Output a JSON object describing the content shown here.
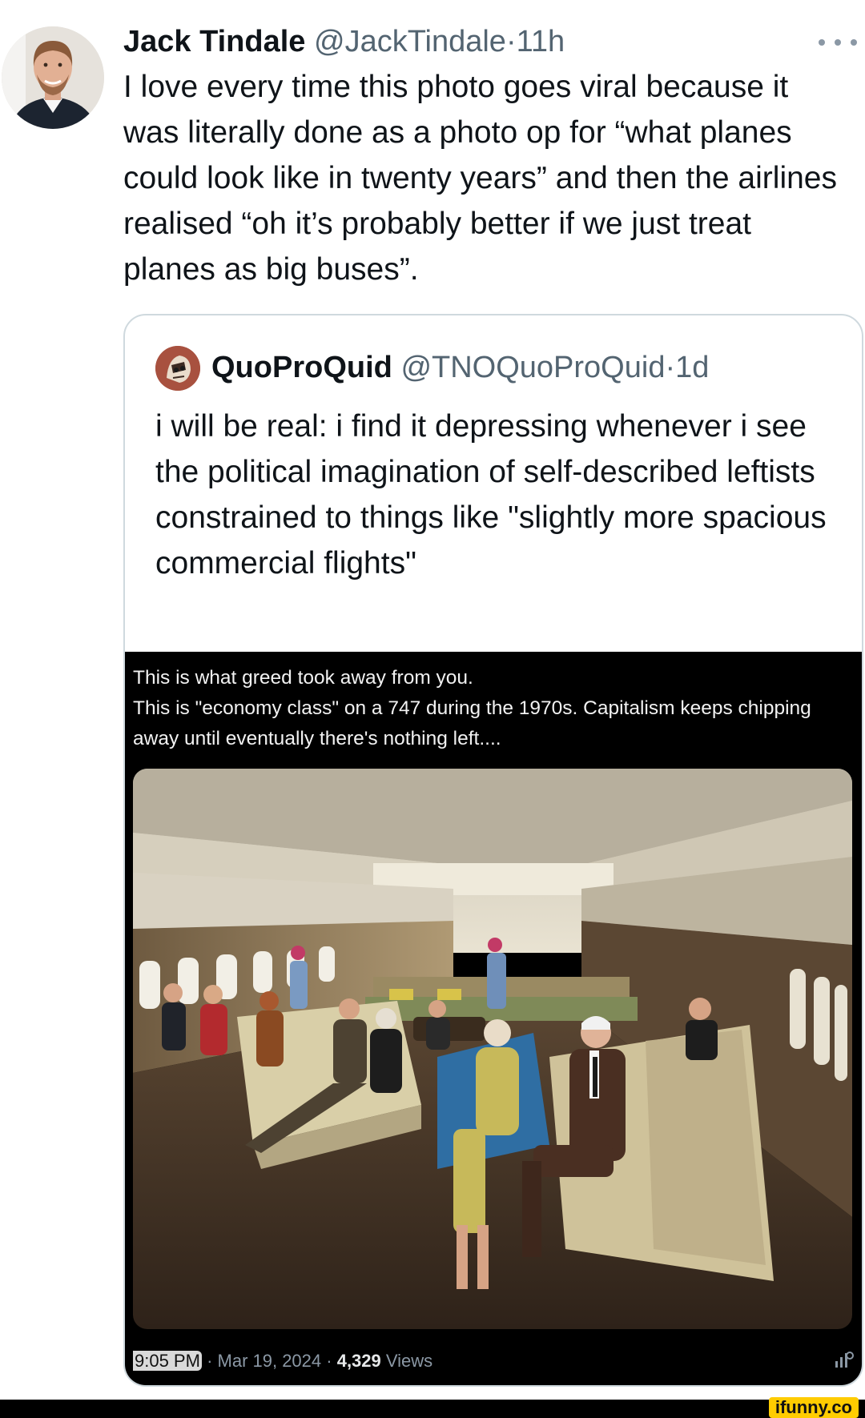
{
  "tweet": {
    "author_name": "Jack Tindale",
    "author_handle": "@JackTindale",
    "separator": "·",
    "time": "11h",
    "more_icon": "more-horizontal-icon",
    "text": "I love every time this photo goes viral because it was literally done as a photo op for “what planes could look like in twenty years” and then the airlines realised “oh it’s probably better if we just treat planes as big buses”."
  },
  "quoted_tweet": {
    "author_name": "QuoProQuid",
    "author_handle": "@TNOQuoProQuid",
    "separator": "·",
    "time": "1d",
    "text": "i will be real: i find it depressing whenever i see the political imagination of self-described leftists constrained to things like \"slightly more spacious commercial flights\"",
    "embed": {
      "caption_line1": "This is what greed took away from you.",
      "caption_line2": "This is \"economy class\" on a 747 during the 1970s. Capitalism keeps chipping away until eventually there's nothing left....",
      "meta_time": "9:05 PM",
      "meta_date": "· Mar 19, 2024 ·",
      "meta_views_count": "4,329",
      "meta_views_label": "Views",
      "stats_icon": "analytics-icon"
    }
  },
  "watermark": {
    "label": "ifunny.co"
  },
  "colors": {
    "secondary_text": "#536471",
    "card_border": "#cfd9de",
    "watermark_bg": "#ffcc00"
  }
}
